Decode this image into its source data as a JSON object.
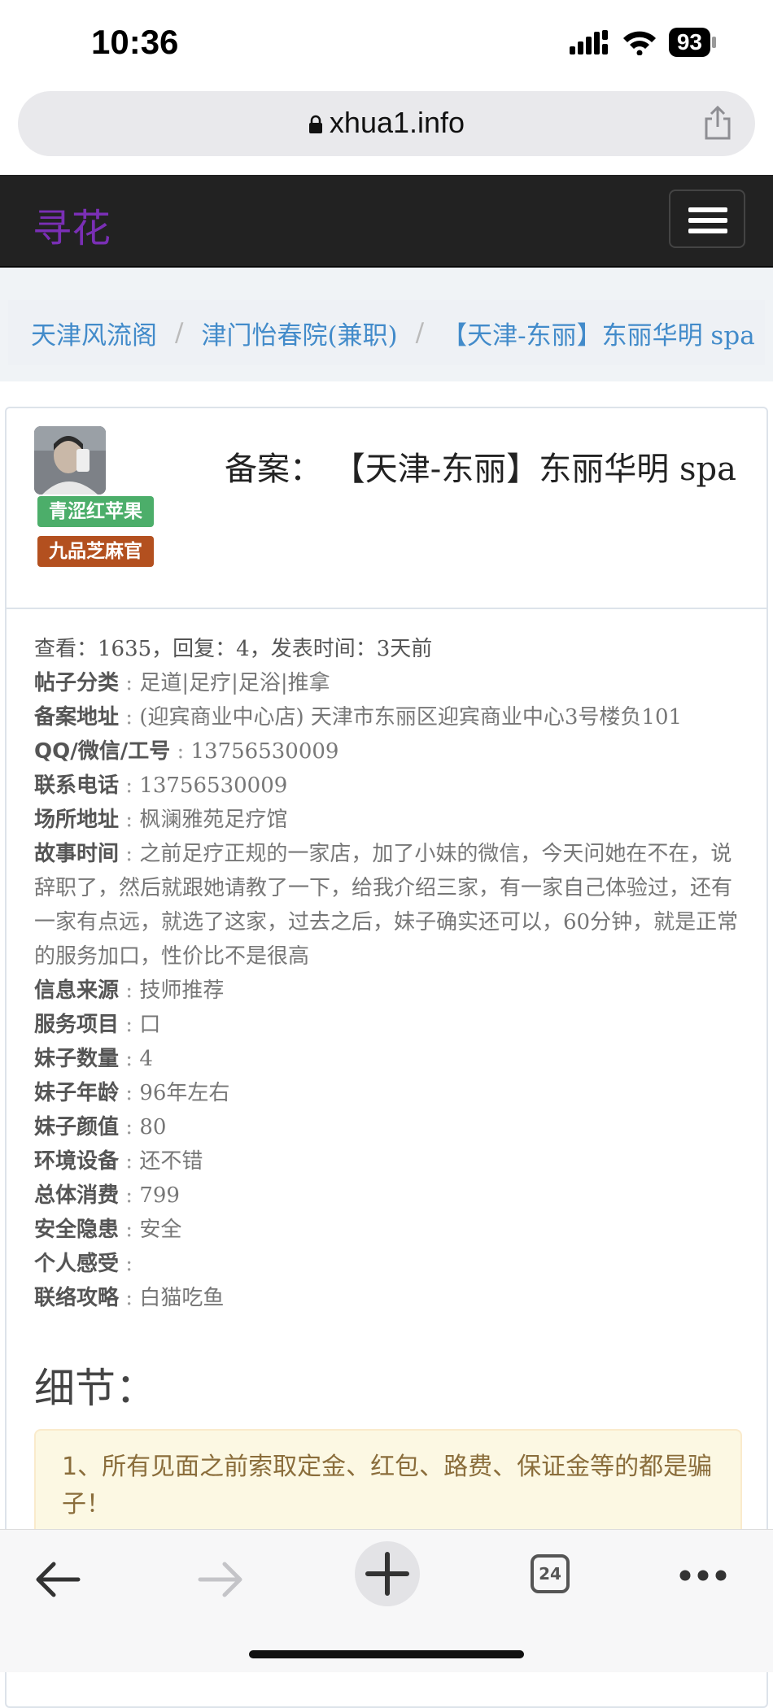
{
  "status": {
    "time": "10:36",
    "battery": "93"
  },
  "browser": {
    "url": "xhua1.info",
    "tab_count": "24"
  },
  "navbar": {
    "brand": "寻花"
  },
  "breadcrumb": [
    {
      "label": "天津风流阁"
    },
    {
      "label": "津门怡春院(兼职)"
    },
    {
      "label": "【天津-东丽】东丽华明 spa"
    }
  ],
  "author": {
    "badges": [
      "青涩红苹果",
      "九品芝麻官"
    ]
  },
  "post": {
    "title_prefix": "备案：",
    "title": "【天津-东丽】东丽华明 spa",
    "meta": "查看：1635，回复：4，发表时间：3天前",
    "fields": [
      {
        "key": "帖子分类",
        "value": "足道|足疗|足浴|推拿"
      },
      {
        "key": "备案地址",
        "value": "(迎宾商业中心店) 天津市东丽区迎宾商业中心3号楼负101"
      },
      {
        "key": "QQ/微信/工号",
        "value": "13756530009"
      },
      {
        "key": "联系电话",
        "value": "13756530009"
      },
      {
        "key": "场所地址",
        "value": "枫澜雅苑足疗馆"
      },
      {
        "key": "故事时间",
        "value": "之前足疗正规的一家店，加了小妹的微信，今天问她在不在，说辞职了，然后就跟她请教了一下，给我介绍三家，有一家自己体验过，还有一家有点远，就选了这家，过去之后，妹子确实还可以，60分钟，就是正常的服务加口，性价比不是很高"
      },
      {
        "key": "信息来源",
        "value": "技师推荐"
      },
      {
        "key": "服务项目",
        "value": "口"
      },
      {
        "key": "妹子数量",
        "value": "4"
      },
      {
        "key": "妹子年龄",
        "value": "96年左右"
      },
      {
        "key": "妹子颜值",
        "value": "80"
      },
      {
        "key": "环境设备",
        "value": "还不错"
      },
      {
        "key": "总体消费",
        "value": "799"
      },
      {
        "key": "安全隐患",
        "value": "安全"
      },
      {
        "key": "个人感受",
        "value": ""
      },
      {
        "key": "联络攻略",
        "value": "白猫吃鱼"
      }
    ],
    "details_heading": "细节：",
    "warning": "1、所有见面之前索取定金、红包、路费、保证金等的都是骗子！"
  }
}
